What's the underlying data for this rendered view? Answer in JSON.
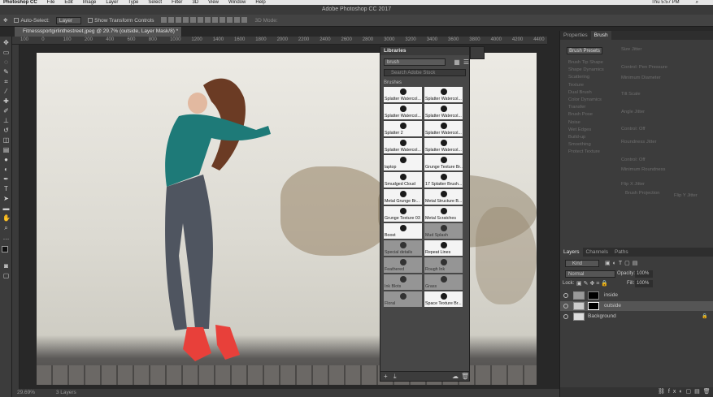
{
  "mac_menu": {
    "app": "Photoshop CC",
    "items": [
      "File",
      "Edit",
      "Image",
      "Layer",
      "Type",
      "Select",
      "Filter",
      "3D",
      "View",
      "Window",
      "Help"
    ],
    "clock": "Thu 5:57 PM"
  },
  "window_title": "Adobe Photoshop CC 2017",
  "options_bar": {
    "auto_select": "Auto-Select:",
    "auto_select_value": "Layer",
    "transform": "Show Transform Controls",
    "mode_3d": "3D Mode:"
  },
  "document_tab": "Fitnesssportgirlinthestreet.jpeg @ 29.7% (outside, Layer Mask/8) *",
  "ruler_marks": [
    "100",
    "0",
    "100",
    "200",
    "400",
    "600",
    "800",
    "1000",
    "1200",
    "1400",
    "1600",
    "1800",
    "2000",
    "2200",
    "2400",
    "2600",
    "2800",
    "3000",
    "3200",
    "3400",
    "3600",
    "3800",
    "4000",
    "4200",
    "4400"
  ],
  "status_bar": {
    "zoom": "29.69%",
    "info": "3 Layers"
  },
  "libraries": {
    "title": "Libraries",
    "selected_library": "brush",
    "search_placeholder": "Search Adobe Stock",
    "section": "Brushes",
    "items": [
      {
        "label": "Splatter Watercol...",
        "dim": false
      },
      {
        "label": "Splatter Watercol...",
        "dim": false
      },
      {
        "label": "Splatter Watercol...",
        "dim": false
      },
      {
        "label": "Splatter Watercol...",
        "dim": false
      },
      {
        "label": "Splatter 2",
        "dim": false
      },
      {
        "label": "Splatter Watercol...",
        "dim": false
      },
      {
        "label": "Splatter Watercol...",
        "dim": false
      },
      {
        "label": "Splatter Watercol...",
        "dim": false
      },
      {
        "label": "laptop",
        "dim": false
      },
      {
        "label": "Grunge Texture Br...",
        "dim": false
      },
      {
        "label": "Smudged Cloud",
        "dim": false
      },
      {
        "label": "17 Splatter Brush...",
        "dim": false
      },
      {
        "label": "Metal Grunge Br...",
        "dim": false
      },
      {
        "label": "Metal Structure B...",
        "dim": false
      },
      {
        "label": "Grunge Texture 03",
        "dim": false
      },
      {
        "label": "Metal Scratches",
        "dim": false
      },
      {
        "label": "Boost",
        "dim": false
      },
      {
        "label": "Mud Splash",
        "dim": true
      },
      {
        "label": "Special details",
        "dim": true
      },
      {
        "label": "Repeat Lines",
        "dim": false
      },
      {
        "label": "Feathered",
        "dim": true
      },
      {
        "label": "Rough Ink",
        "dim": true
      },
      {
        "label": "Ink Blots",
        "dim": true
      },
      {
        "label": "Grass",
        "dim": true
      },
      {
        "label": "Floral",
        "dim": true
      },
      {
        "label": "Space Texture Br...",
        "dim": false
      }
    ]
  },
  "brush_panel": {
    "tabs": [
      "Properties",
      "Brush"
    ],
    "active_tab": "Brush",
    "presets_button": "Brush Presets",
    "options": [
      "Brush Tip Shape",
      "Shape Dynamics",
      "Scattering",
      "Texture",
      "Dual Brush",
      "Color Dynamics",
      "Transfer",
      "Brush Pose",
      "Noise",
      "Wet Edges",
      "Build-up",
      "Smoothing",
      "Protect Texture"
    ],
    "right_options": [
      "Size Jitter",
      "Control: Pen Pressure",
      "Minimum Diameter",
      "Tilt Scale",
      "Angle Jitter",
      "Control: Off",
      "Roundness Jitter",
      "Control: Off",
      "Minimum Roundness",
      "Flip X Jitter",
      "Flip Y Jitter",
      "Brush Projection"
    ]
  },
  "layers_panel": {
    "tabs": [
      "Layers",
      "Channels",
      "Paths"
    ],
    "active_tab": "Layers",
    "filter": "Kind",
    "blend_mode": "Normal",
    "opacity_label": "Opacity:",
    "opacity": "100%",
    "lock_label": "Lock:",
    "fill_label": "Fill:",
    "fill": "100%",
    "layers": [
      {
        "name": "inside"
      },
      {
        "name": "outside"
      },
      {
        "name": "Background"
      }
    ]
  }
}
